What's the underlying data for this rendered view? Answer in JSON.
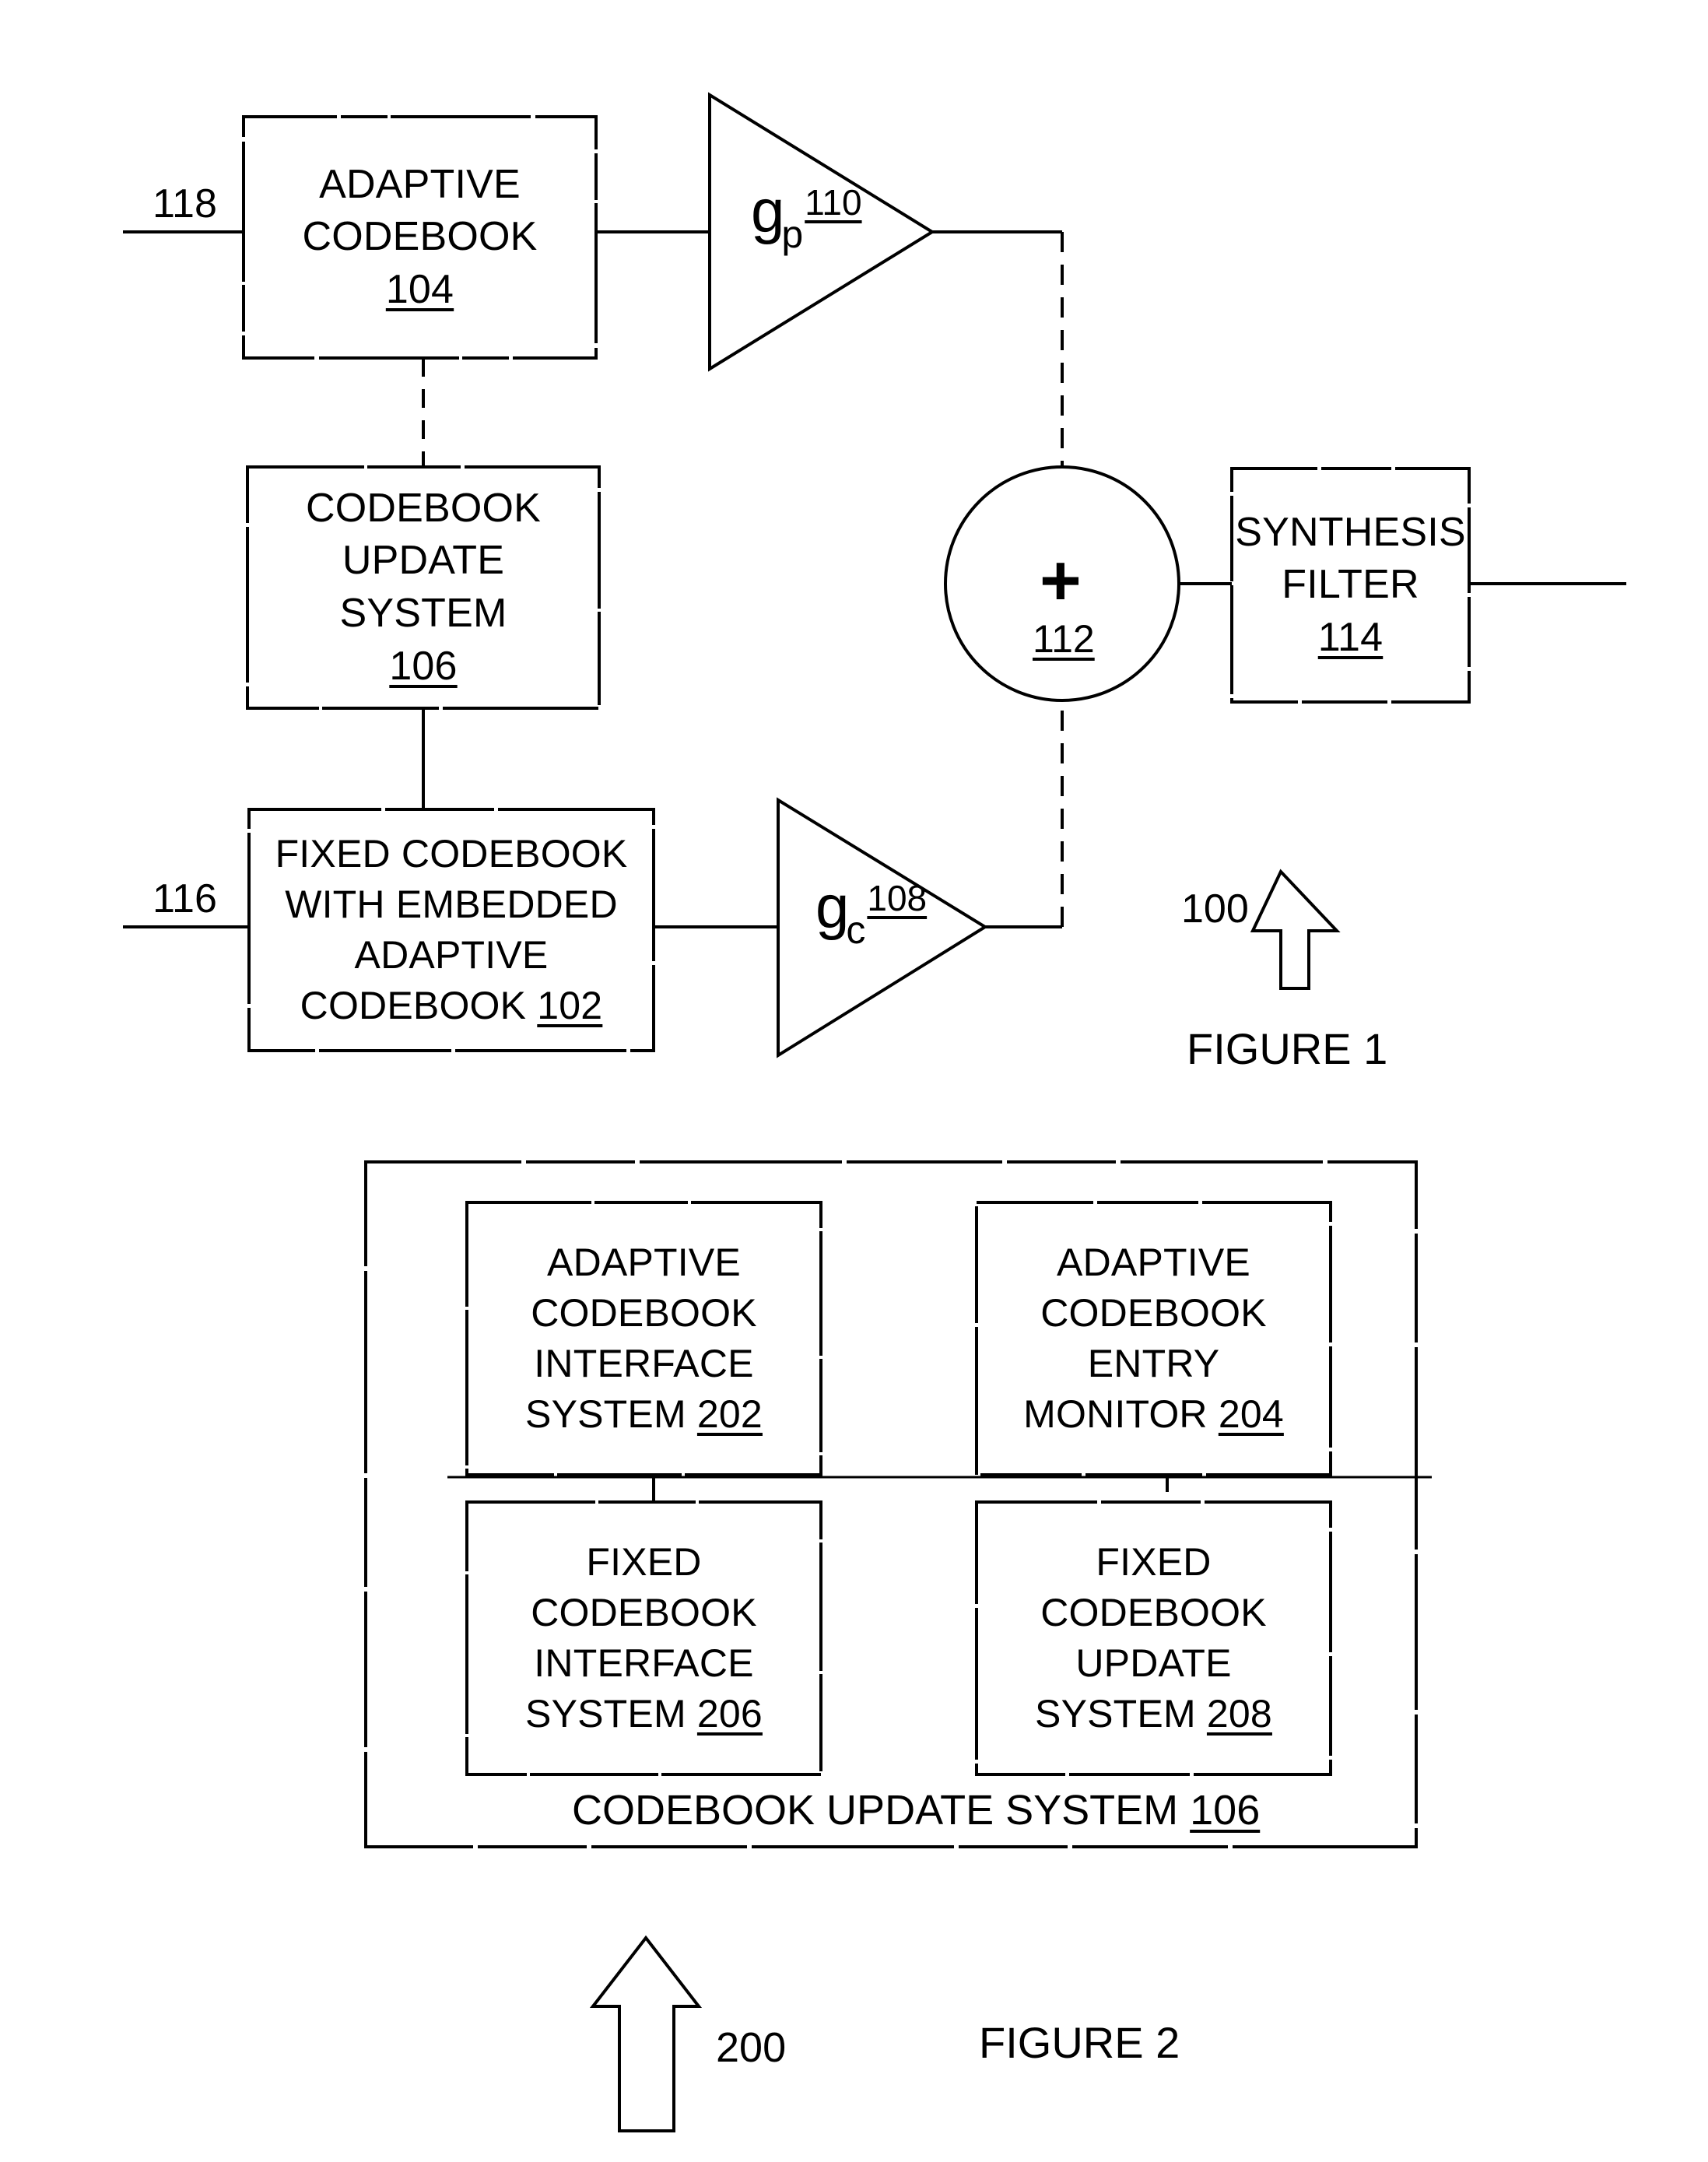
{
  "document": {
    "type": "patent-drawing-sheet",
    "figures": [
      "FIGURE 1",
      "FIGURE 2"
    ]
  },
  "figure1": {
    "caption": "FIGURE 1",
    "system_ref": "100",
    "inputs": [
      {
        "name": "adaptive-codebook-input",
        "ref": "118"
      },
      {
        "name": "fixed-codebook-input",
        "ref": "116"
      }
    ],
    "blocks": {
      "adaptive_codebook": {
        "lines": [
          "ADAPTIVE",
          "CODEBOOK"
        ],
        "ref": "104"
      },
      "codebook_update_system": {
        "lines": [
          "CODEBOOK",
          "UPDATE",
          "SYSTEM"
        ],
        "ref": "106"
      },
      "fixed_codebook": {
        "lines": [
          "FIXED CODEBOOK",
          "WITH EMBEDDED",
          "ADAPTIVE"
        ],
        "last_line_prefix": "CODEBOOK ",
        "ref": "102"
      },
      "synthesis_filter": {
        "lines": [
          "SYNTHESIS",
          "FILTER"
        ],
        "ref": "114"
      },
      "summer": {
        "symbol": "+",
        "ref": "112"
      }
    },
    "gains": {
      "pitch_gain": {
        "symbol": "g",
        "subscript": "p",
        "ref": "110"
      },
      "code_gain": {
        "symbol": "g",
        "subscript": "c",
        "ref": "108"
      }
    }
  },
  "figure2": {
    "caption": "FIGURE 2",
    "system_ref": "200",
    "container": {
      "title_prefix": "CODEBOOK UPDATE SYSTEM ",
      "title_ref": "106"
    },
    "blocks": [
      {
        "name": "adaptive-codebook-interface-system",
        "lines": [
          "ADAPTIVE",
          "CODEBOOK",
          "INTERFACE"
        ],
        "last_line_prefix": "SYSTEM ",
        "ref": "202"
      },
      {
        "name": "adaptive-codebook-entry-monitor",
        "lines": [
          "ADAPTIVE",
          "CODEBOOK",
          "ENTRY"
        ],
        "last_line_prefix": "MONITOR ",
        "ref": "204"
      },
      {
        "name": "fixed-codebook-interface-system",
        "lines": [
          "FIXED",
          "CODEBOOK",
          "INTERFACE"
        ],
        "last_line_prefix": "SYSTEM ",
        "ref": "206"
      },
      {
        "name": "fixed-codebook-update-system",
        "lines": [
          "FIXED",
          "CODEBOOK",
          "UPDATE"
        ],
        "last_line_prefix": "SYSTEM ",
        "ref": "208"
      }
    ]
  },
  "style": {
    "ink": "#000000",
    "paper": "#ffffff"
  }
}
